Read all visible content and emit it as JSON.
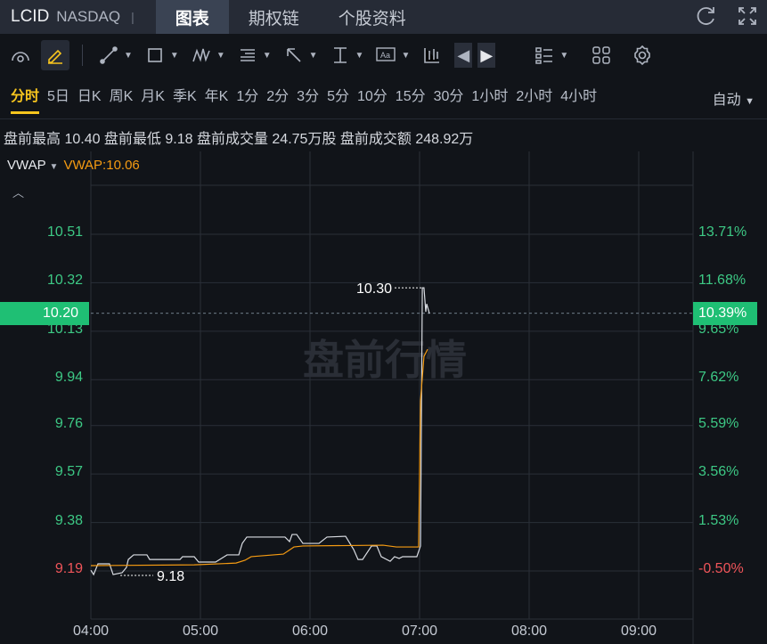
{
  "header": {
    "symbol": "LCID",
    "exchange": "NASDAQ",
    "separator": "|",
    "tabs": [
      "图表",
      "期权链",
      "个股资料"
    ]
  },
  "toolbar": {
    "icons": [
      "gauge-icon",
      "pencil-icon",
      "line-tool-icon",
      "rectangle-tool-icon",
      "pattern-tool-icon",
      "fib-tool-icon",
      "arrow-tool-icon",
      "measure-tool-icon",
      "text-tool-icon",
      "candle-icon",
      "prev-icon",
      "next-icon",
      "layout-list-icon",
      "grid-icon",
      "settings-icon"
    ]
  },
  "periods": [
    "分时",
    "5日",
    "日K",
    "周K",
    "月K",
    "季K",
    "年K",
    "1分",
    "2分",
    "3分",
    "5分",
    "10分",
    "15分",
    "30分",
    "1小时",
    "2小时",
    "4小时"
  ],
  "active_period": "分时",
  "auto_label": "自动",
  "stats": "盘前最高 10.40 盘前最低 9.18 盘前成交量 24.75万股 盘前成交额 248.92万",
  "indicator": {
    "name": "VWAP",
    "value": "VWAP:10.06"
  },
  "watermark": "盘前行情",
  "colors": {
    "price": "#d9dce2",
    "vwap": "#f59b12",
    "up": "#3dc985",
    "down": "#f0555a",
    "tag": "#1fbf74"
  },
  "chart_data": {
    "type": "line",
    "y_ticks": [
      "10.51",
      "10.32",
      "10.13",
      "9.94",
      "9.76",
      "9.57",
      "9.38",
      "9.19"
    ],
    "y_values": [
      10.51,
      10.32,
      10.13,
      9.94,
      9.76,
      9.57,
      9.38,
      9.19
    ],
    "pct_ticks": [
      "13.71%",
      "11.68%",
      "9.65%",
      "7.62%",
      "5.59%",
      "3.56%",
      "1.53%",
      "-0.50%"
    ],
    "x_ticks": [
      "04:00",
      "05:00",
      "06:00",
      "07:00",
      "08:00",
      "09:00"
    ],
    "ylim": [
      9.19,
      10.51
    ],
    "x_minutes_range": [
      0,
      330
    ],
    "current_price": "10.20",
    "current_pct": "10.39%",
    "current_value": 10.2,
    "high_label": "10.30",
    "high": {
      "minute": 182,
      "value": 10.3
    },
    "low_label": "9.18",
    "low": {
      "minute": 1.5,
      "value": 9.176
    },
    "series": [
      {
        "name": "price",
        "points": [
          [
            0,
            9.193
          ],
          [
            1.5,
            9.176
          ],
          [
            3.9,
            9.218
          ],
          [
            10.2,
            9.218
          ],
          [
            12.2,
            9.176
          ],
          [
            17.1,
            9.183
          ],
          [
            19.5,
            9.204
          ],
          [
            20.5,
            9.235
          ],
          [
            23.4,
            9.253
          ],
          [
            30.7,
            9.253
          ],
          [
            32.2,
            9.235
          ],
          [
            48.8,
            9.235
          ],
          [
            50.2,
            9.246
          ],
          [
            56.6,
            9.246
          ],
          [
            59,
            9.225
          ],
          [
            68.3,
            9.225
          ],
          [
            74.6,
            9.253
          ],
          [
            81,
            9.253
          ],
          [
            82.9,
            9.298
          ],
          [
            85.4,
            9.323
          ],
          [
            106.3,
            9.323
          ],
          [
            108.8,
            9.305
          ],
          [
            110.2,
            9.333
          ],
          [
            112.7,
            9.333
          ],
          [
            116.1,
            9.298
          ],
          [
            124.9,
            9.298
          ],
          [
            126.8,
            9.309
          ],
          [
            129.3,
            9.323
          ],
          [
            139.5,
            9.326
          ],
          [
            143.9,
            9.274
          ],
          [
            146.3,
            9.235
          ],
          [
            148.8,
            9.235
          ],
          [
            153.7,
            9.288
          ],
          [
            156.6,
            9.288
          ],
          [
            159,
            9.246
          ],
          [
            163.9,
            9.228
          ],
          [
            166.3,
            9.246
          ],
          [
            168.8,
            9.239
          ],
          [
            170.7,
            9.246
          ],
          [
            178.5,
            9.246
          ],
          [
            180.5,
            9.288
          ],
          [
            181.5,
            10.3
          ],
          [
            182.4,
            10.3
          ],
          [
            183.4,
            10.206
          ],
          [
            183.9,
            10.237
          ],
          [
            185.4,
            10.199
          ]
        ]
      },
      {
        "name": "VWAP",
        "points": [
          [
            0,
            9.211
          ],
          [
            56.6,
            9.214
          ],
          [
            79.5,
            9.221
          ],
          [
            84.4,
            9.232
          ],
          [
            87.8,
            9.246
          ],
          [
            105.4,
            9.256
          ],
          [
            111.2,
            9.284
          ],
          [
            116.1,
            9.288
          ],
          [
            160,
            9.291
          ],
          [
            167.3,
            9.284
          ],
          [
            179.5,
            9.284
          ],
          [
            180.5,
            9.857
          ],
          [
            182.4,
            10.031
          ],
          [
            184.4,
            10.059
          ]
        ]
      }
    ]
  }
}
